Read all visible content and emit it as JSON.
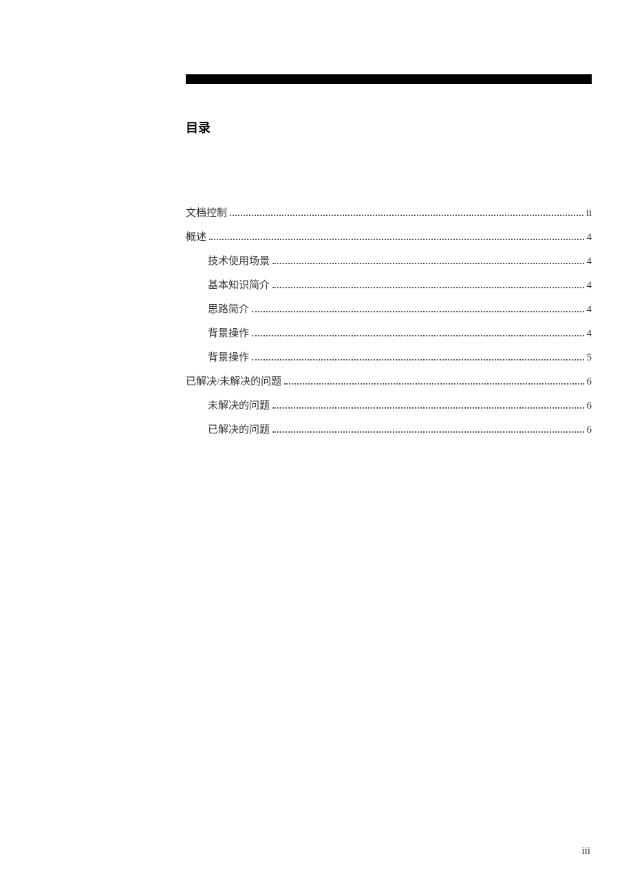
{
  "title": "目录",
  "toc": [
    {
      "level": 0,
      "label": "文档控制",
      "page": "ii"
    },
    {
      "level": 0,
      "label": "概述",
      "page": "4"
    },
    {
      "level": 1,
      "label": "技术使用场景",
      "page": "4"
    },
    {
      "level": 1,
      "label": "基本知识简介",
      "page": "4"
    },
    {
      "level": 1,
      "label": "思路简介",
      "page": "4"
    },
    {
      "level": 1,
      "label": "背景操作",
      "page": "4"
    },
    {
      "level": 1,
      "label": "背景操作",
      "page": "5"
    },
    {
      "level": 0,
      "label": "已解决/未解决的问题",
      "page": "6"
    },
    {
      "level": 1,
      "label": "未解决的问题",
      "page": "6"
    },
    {
      "level": 1,
      "label": "已解决的问题",
      "page": "6"
    }
  ],
  "page_number": "iii"
}
